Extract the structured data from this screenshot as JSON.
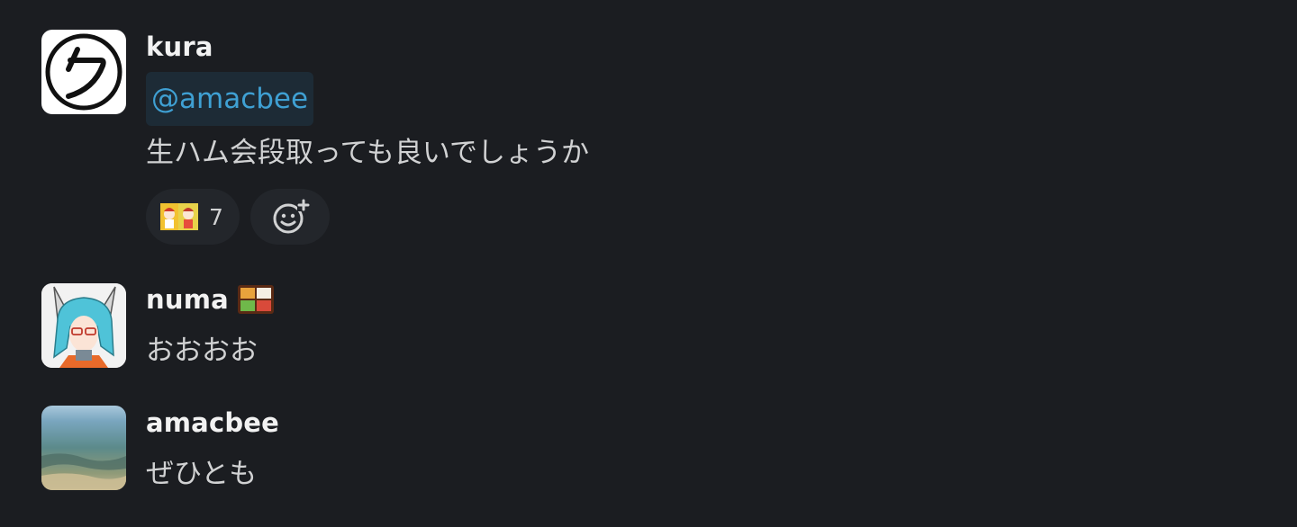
{
  "messages": [
    {
      "username": "kura",
      "mention": "@amacbee",
      "text": "生ハム会段取っても良いでしょうか",
      "reaction": {
        "icon": "people-emoji",
        "count": "7"
      },
      "add_reaction_icon": "add-reaction-icon"
    },
    {
      "username": "numa",
      "status_icon": "bento-box-emoji",
      "text": "おおおお"
    },
    {
      "username": "amacbee",
      "text": "ぜひとも"
    }
  ],
  "colors": {
    "background": "#1b1d21",
    "username": "#f2f2f2",
    "text": "#d1d2d3",
    "mention_text": "#3fa0d3",
    "mention_bg": "#1d2b36",
    "reaction_bg": "#23262b"
  }
}
